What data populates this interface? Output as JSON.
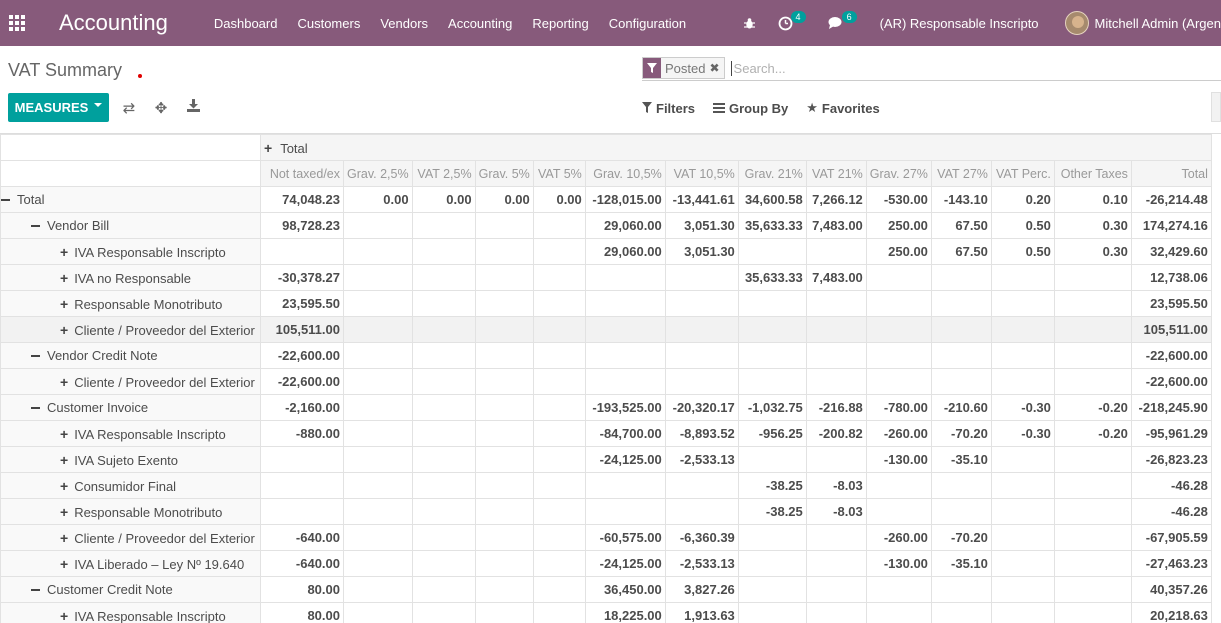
{
  "navbar": {
    "brand": "Accounting",
    "menu": [
      "Dashboard",
      "Customers",
      "Vendors",
      "Accounting",
      "Reporting",
      "Configuration"
    ],
    "activities_count": "4",
    "messages_count": "6",
    "company": "(AR) Responsable Inscripto",
    "user": "Mitchell Admin (Argen"
  },
  "control": {
    "title": "VAT Summary",
    "facet": "Posted",
    "search_placeholder": "Search...",
    "measures_label": "MEASURES",
    "filters_label": "Filters",
    "groupby_label": "Group By",
    "favorites_label": "Favorites"
  },
  "pivot": {
    "column_group": "Total",
    "measures": [
      "Not taxed/ex",
      "Grav. 2,5%",
      "VAT 2,5%",
      "Grav. 5%",
      "VAT 5%",
      "Grav. 10,5%",
      "VAT 10,5%",
      "Grav. 21%",
      "VAT 21%",
      "Grav. 27%",
      "VAT 27%",
      "VAT Perc.",
      "Other Taxes",
      "Total"
    ],
    "rows": [
      {
        "label": "Total",
        "level": 0,
        "open": true,
        "values": [
          "74,048.23",
          "0.00",
          "0.00",
          "0.00",
          "0.00",
          "-128,015.00",
          "-13,441.61",
          "34,600.58",
          "7,266.12",
          "-530.00",
          "-143.10",
          "0.20",
          "0.10",
          "-26,214.48"
        ]
      },
      {
        "label": "Vendor Bill",
        "level": 1,
        "open": true,
        "values": [
          "98,728.23",
          "",
          "",
          "",
          "",
          "29,060.00",
          "3,051.30",
          "35,633.33",
          "7,483.00",
          "250.00",
          "67.50",
          "0.50",
          "0.30",
          "174,274.16"
        ]
      },
      {
        "label": "IVA Responsable Inscripto",
        "level": 2,
        "open": false,
        "values": [
          "",
          "",
          "",
          "",
          "",
          "29,060.00",
          "3,051.30",
          "",
          "",
          "250.00",
          "67.50",
          "0.50",
          "0.30",
          "32,429.60"
        ]
      },
      {
        "label": "IVA no Responsable",
        "level": 2,
        "open": false,
        "values": [
          "-30,378.27",
          "",
          "",
          "",
          "",
          "",
          "",
          "35,633.33",
          "7,483.00",
          "",
          "",
          "",
          "",
          "12,738.06"
        ]
      },
      {
        "label": "Responsable Monotributo",
        "level": 2,
        "open": false,
        "values": [
          "23,595.50",
          "",
          "",
          "",
          "",
          "",
          "",
          "",
          "",
          "",
          "",
          "",
          "",
          "23,595.50"
        ]
      },
      {
        "label": "Cliente / Proveedor del Exterior",
        "level": 2,
        "open": false,
        "values": [
          "105,511.00",
          "",
          "",
          "",
          "",
          "",
          "",
          "",
          "",
          "",
          "",
          "",
          "",
          "105,511.00"
        ]
      },
      {
        "label": "Vendor Credit Note",
        "level": 1,
        "open": true,
        "values": [
          "-22,600.00",
          "",
          "",
          "",
          "",
          "",
          "",
          "",
          "",
          "",
          "",
          "",
          "",
          "-22,600.00"
        ]
      },
      {
        "label": "Cliente / Proveedor del Exterior",
        "level": 2,
        "open": false,
        "values": [
          "-22,600.00",
          "",
          "",
          "",
          "",
          "",
          "",
          "",
          "",
          "",
          "",
          "",
          "",
          "-22,600.00"
        ]
      },
      {
        "label": "Customer Invoice",
        "level": 1,
        "open": true,
        "values": [
          "-2,160.00",
          "",
          "",
          "",
          "",
          "-193,525.00",
          "-20,320.17",
          "-1,032.75",
          "-216.88",
          "-780.00",
          "-210.60",
          "-0.30",
          "-0.20",
          "-218,245.90"
        ]
      },
      {
        "label": "IVA Responsable Inscripto",
        "level": 2,
        "open": false,
        "values": [
          "-880.00",
          "",
          "",
          "",
          "",
          "-84,700.00",
          "-8,893.52",
          "-956.25",
          "-200.82",
          "-260.00",
          "-70.20",
          "-0.30",
          "-0.20",
          "-95,961.29"
        ]
      },
      {
        "label": "IVA Sujeto Exento",
        "level": 2,
        "open": false,
        "values": [
          "",
          "",
          "",
          "",
          "",
          "-24,125.00",
          "-2,533.13",
          "",
          "",
          "-130.00",
          "-35.10",
          "",
          "",
          "-26,823.23"
        ]
      },
      {
        "label": "Consumidor Final",
        "level": 2,
        "open": false,
        "values": [
          "",
          "",
          "",
          "",
          "",
          "",
          "",
          "-38.25",
          "-8.03",
          "",
          "",
          "",
          "",
          "-46.28"
        ]
      },
      {
        "label": "Responsable Monotributo",
        "level": 2,
        "open": false,
        "values": [
          "",
          "",
          "",
          "",
          "",
          "",
          "",
          "-38.25",
          "-8.03",
          "",
          "",
          "",
          "",
          "-46.28"
        ]
      },
      {
        "label": "Cliente / Proveedor del Exterior",
        "level": 2,
        "open": false,
        "values": [
          "-640.00",
          "",
          "",
          "",
          "",
          "-60,575.00",
          "-6,360.39",
          "",
          "",
          "-260.00",
          "-70.20",
          "",
          "",
          "-67,905.59"
        ]
      },
      {
        "label": "IVA Liberado – Ley Nº 19.640",
        "level": 2,
        "open": false,
        "values": [
          "-640.00",
          "",
          "",
          "",
          "",
          "-24,125.00",
          "-2,533.13",
          "",
          "",
          "-130.00",
          "-35.10",
          "",
          "",
          "-27,463.23"
        ]
      },
      {
        "label": "Customer Credit Note",
        "level": 1,
        "open": true,
        "values": [
          "80.00",
          "",
          "",
          "",
          "",
          "36,450.00",
          "3,827.26",
          "",
          "",
          "",
          "",
          "",
          "",
          "40,357.26"
        ]
      },
      {
        "label": "IVA Responsable Inscripto",
        "level": 2,
        "open": false,
        "values": [
          "80.00",
          "",
          "",
          "",
          "",
          "18,225.00",
          "1,913.63",
          "",
          "",
          "",
          "",
          "",
          "",
          "20,218.63"
        ]
      }
    ]
  }
}
